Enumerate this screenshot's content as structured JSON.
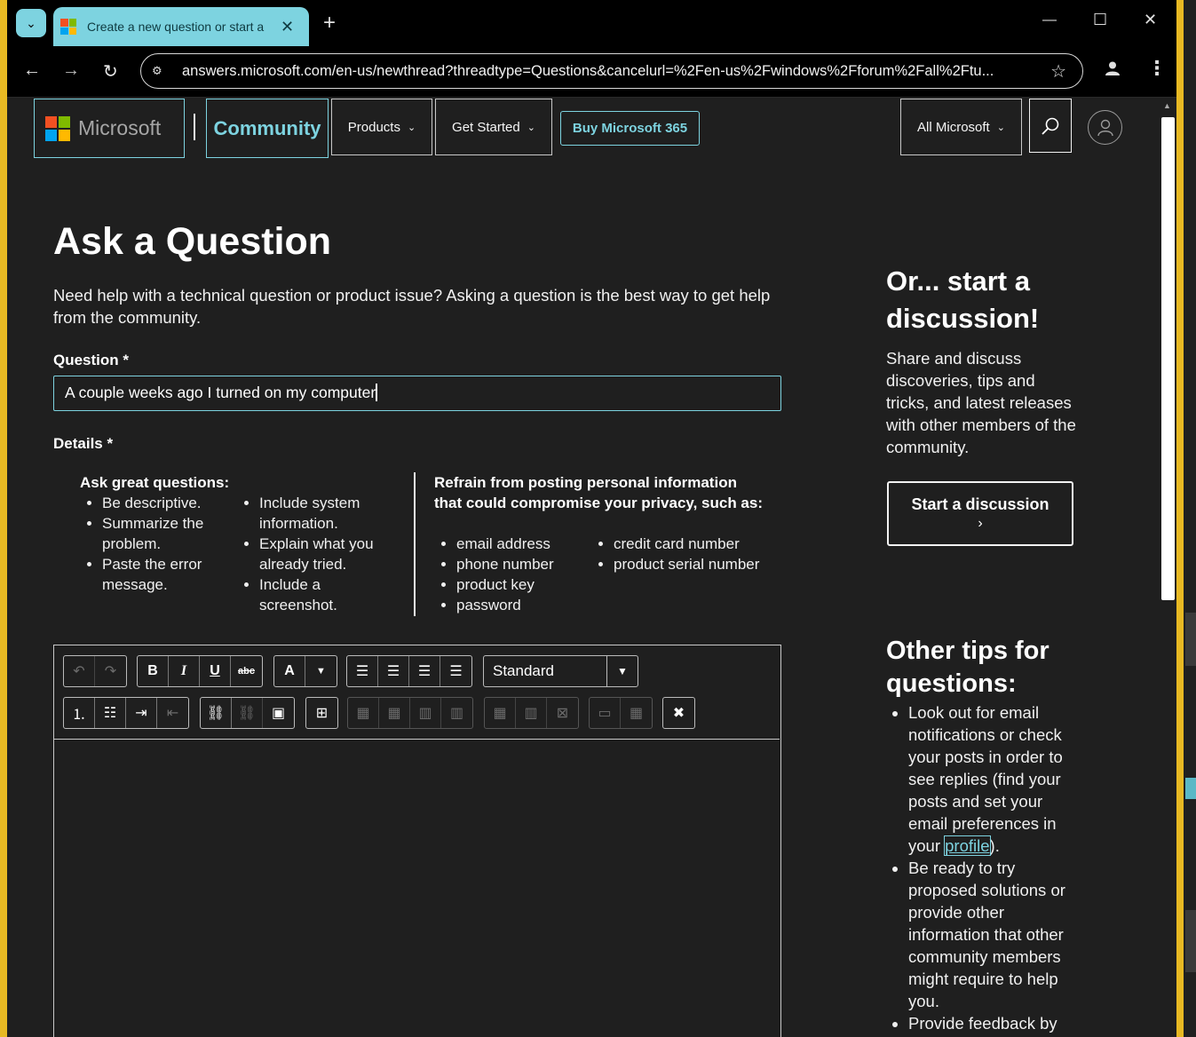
{
  "browser": {
    "tab_title": "Create a new question or start a",
    "tab_close": "✕",
    "new_tab": "+",
    "url": "answers.microsoft.com/en-us/newthread?threadtype=Questions&cancelurl=%2Fen-us%2Fwindows%2Fforum%2Fall%2Ftu...",
    "icons": {
      "tab_dropdown": "chevron-down-icon",
      "back": "back-arrow-icon",
      "forward": "forward-arrow-icon",
      "reload": "reload-icon",
      "site_info": "tune-icon",
      "bookmark": "star-icon",
      "profile": "person-icon",
      "menu": "kebab-menu-icon"
    }
  },
  "header": {
    "logo_text": "Microsoft",
    "community_label": "Community",
    "nav": [
      {
        "label": "Products"
      },
      {
        "label": "Get Started"
      }
    ],
    "buy_label": "Buy Microsoft 365",
    "all_microsoft_label": "All Microsoft",
    "accent_color": "#7dd3e0"
  },
  "main": {
    "title": "Ask a Question",
    "intro": "Need help with a technical question or product issue? Asking a question is the best way to get help from the community.",
    "question_label": "Question *",
    "question_value": "A couple weeks ago I turned on my computer",
    "details_label": "Details *",
    "great_questions": {
      "heading": "Ask great questions:",
      "col1": [
        "Be descriptive.",
        "Summarize the problem.",
        "Paste the error message."
      ],
      "col2": [
        "Include system information.",
        "Explain what you already tried.",
        "Include a screenshot."
      ]
    },
    "privacy": {
      "heading": "Refrain from posting personal information that could compromise your privacy, such as:",
      "col1": [
        "email address",
        "phone number",
        "product key",
        "password"
      ],
      "col2": [
        "credit card number",
        "product serial number"
      ]
    },
    "editor": {
      "style_value": "Standard"
    }
  },
  "sidebar": {
    "discussion_heading": "Or... start a discussion!",
    "discussion_text": "Share and discuss discoveries, tips and tricks, and latest releases with other members of the community.",
    "start_button": "Start a discussion",
    "tips_heading": "Other tips for questions:",
    "tip1_before": "Look out for email notifications or check your posts in order to see replies (find your posts and set your email preferences in your ",
    "tip1_link": "profile",
    "tip1_after": ").",
    "tip2": "Be ready to try proposed solutions or provide other information that other community members might require to help you.",
    "tip3": "Provide feedback by"
  }
}
